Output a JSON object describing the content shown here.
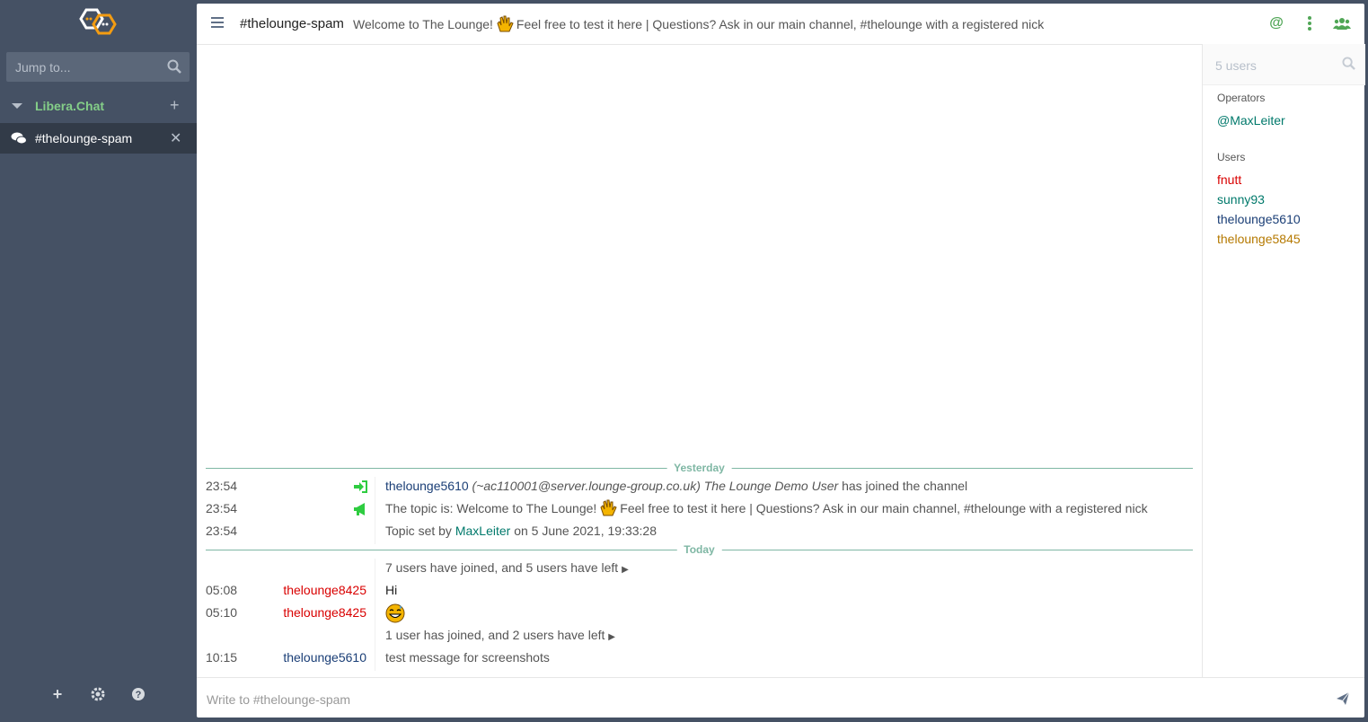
{
  "sidebar": {
    "search_placeholder": "Jump to...",
    "network": {
      "name": "Libera.Chat"
    },
    "channel": {
      "name": "#thelounge-spam"
    }
  },
  "header": {
    "title": "#thelounge-spam",
    "topic_a": "Welcome to The Lounge!",
    "topic_b": "Feel free to test it here | Questions? Ask in our main channel, #thelounge with a registered nick"
  },
  "userlist": {
    "search_placeholder": "5 users",
    "operators_label": "Operators",
    "operators": [
      "@MaxLeiter"
    ],
    "users_label": "Users",
    "users": [
      "fnutt",
      "sunny93",
      "thelounge5610",
      "thelounge5845"
    ]
  },
  "chat": {
    "yesterday": "Yesterday",
    "today": "Today",
    "m1": {
      "time": "23:54",
      "nick": "thelounge5610",
      "host": "(~ac110001@server.lounge-group.co.uk)",
      "realname": "The Lounge Demo User",
      "rest": "has joined the channel"
    },
    "m2": {
      "time": "23:54",
      "a": "The topic is: Welcome to The Lounge!",
      "b": "Feel free to test it here | Questions? Ask in our main channel, #thelounge with a registered nick"
    },
    "m3": {
      "time": "23:54",
      "a": "Topic set by",
      "nick": "MaxLeiter",
      "b": "on 5 June 2021, 19:33:28"
    },
    "m4": {
      "text": "7 users have joined, and 5 users have left"
    },
    "m5": {
      "time": "05:08",
      "nick": "thelounge8425",
      "text": "Hi"
    },
    "m6": {
      "time": "05:10",
      "nick": "thelounge8425"
    },
    "m7": {
      "text": "1 user has joined, and 2 users have left"
    },
    "m8": {
      "time": "10:15",
      "nick": "thelounge5610",
      "text": "test message for screenshots"
    }
  },
  "composer": {
    "placeholder": "Write to #thelounge-spam"
  },
  "colors": {
    "accent": "#50a656",
    "sidebar": "#455164",
    "active": "#323b48",
    "network": "#84ce88",
    "nick_red": "#d90000",
    "nick_teal": "#00796b",
    "nick_blue": "#1a3e76",
    "nick_orange": "#b57900"
  }
}
